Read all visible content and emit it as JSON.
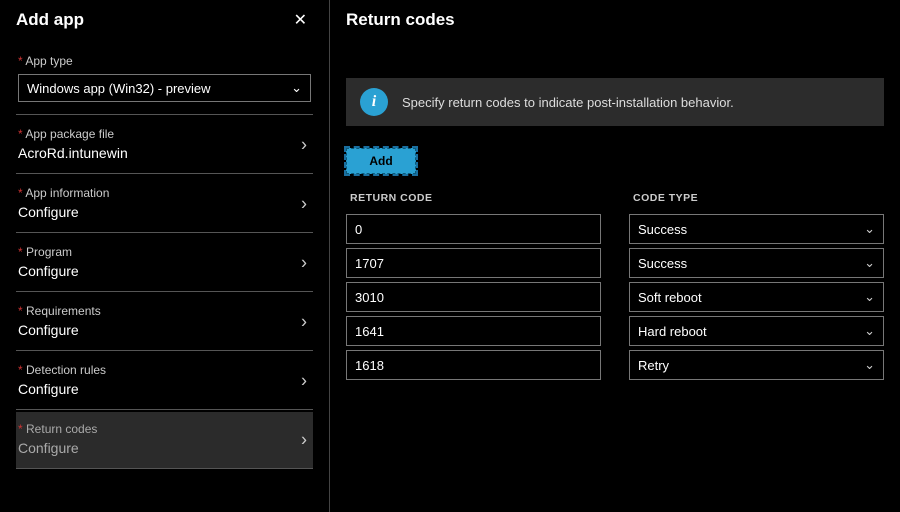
{
  "left": {
    "title": "Add app",
    "close_label": "✕",
    "sections": [
      {
        "label": "App type",
        "value": "Windows app (Win32) - preview",
        "type": "dropdown"
      },
      {
        "label": "App package file",
        "value": "AcroRd.intunewin",
        "type": "nav"
      },
      {
        "label": "App information",
        "value": "Configure",
        "type": "nav"
      },
      {
        "label": "Program",
        "value": "Configure",
        "type": "nav"
      },
      {
        "label": "Requirements",
        "value": "Configure",
        "type": "nav"
      },
      {
        "label": "Detection rules",
        "value": "Configure",
        "type": "nav"
      },
      {
        "label": "Return codes",
        "value": "Configure",
        "type": "nav",
        "active": true
      }
    ]
  },
  "right": {
    "title": "Return codes",
    "info_text": "Specify return codes to indicate post-installation behavior.",
    "add_label": "Add",
    "col_return_code": "RETURN CODE",
    "col_code_type": "CODE TYPE",
    "rows": [
      {
        "code": "0",
        "type": "Success"
      },
      {
        "code": "1707",
        "type": "Success"
      },
      {
        "code": "3010",
        "type": "Soft reboot"
      },
      {
        "code": "1641",
        "type": "Hard reboot"
      },
      {
        "code": "1618",
        "type": "Retry"
      }
    ]
  },
  "icons": {
    "chevron_right": "›",
    "chevron_down": "⌄",
    "info_glyph": "i"
  }
}
